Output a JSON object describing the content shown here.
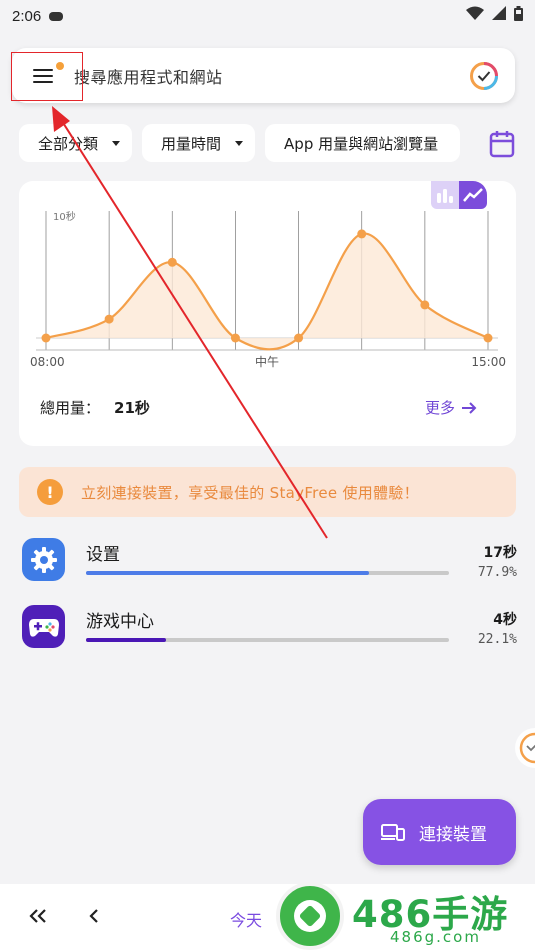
{
  "status_bar": {
    "time": "2:06"
  },
  "search": {
    "placeholder": "搜尋應用程式和網站"
  },
  "filters": {
    "category": "全部分類",
    "metric": "用量時間",
    "scope": "App 用量與網站瀏覽量"
  },
  "chart_data": {
    "type": "area",
    "x_ticks": [
      "08:00",
      "中午",
      "15:00"
    ],
    "y_label": "10秒",
    "points": [
      {
        "x": "08:00",
        "y": 0
      },
      {
        "x": "09:00",
        "y": 2
      },
      {
        "x": "10:00",
        "y": 8
      },
      {
        "x": "11:00",
        "y": 0
      },
      {
        "x": "12:00",
        "y": 0
      },
      {
        "x": "13:00",
        "y": 11
      },
      {
        "x": "14:00",
        "y": 3.5
      },
      {
        "x": "15:00",
        "y": 0
      }
    ],
    "ylim": [
      0,
      13
    ],
    "line_color": "#f4a04a",
    "fill_color": "#fde9d6"
  },
  "summary": {
    "label": "總用量：",
    "value": "21秒",
    "more": "更多"
  },
  "banner": {
    "text": "立刻連接裝置，享受最佳的 StayFree 使用體驗！"
  },
  "apps": [
    {
      "name": "设置",
      "time": "17秒",
      "percent": "77.9%",
      "fraction": 0.779,
      "color": "#4d7ce8"
    },
    {
      "name": "游戏中心",
      "time": "4秒",
      "percent": "22.1%",
      "fraction": 0.221,
      "color": "#4a17b5"
    }
  ],
  "fab": {
    "label": "連接裝置"
  },
  "bottom_nav": {
    "today": "今天"
  },
  "watermark": {
    "title": "486手游网",
    "subtitle": "486g.com"
  },
  "colors": {
    "accent": "#7c4ddb",
    "annotation": "#e3262b"
  }
}
